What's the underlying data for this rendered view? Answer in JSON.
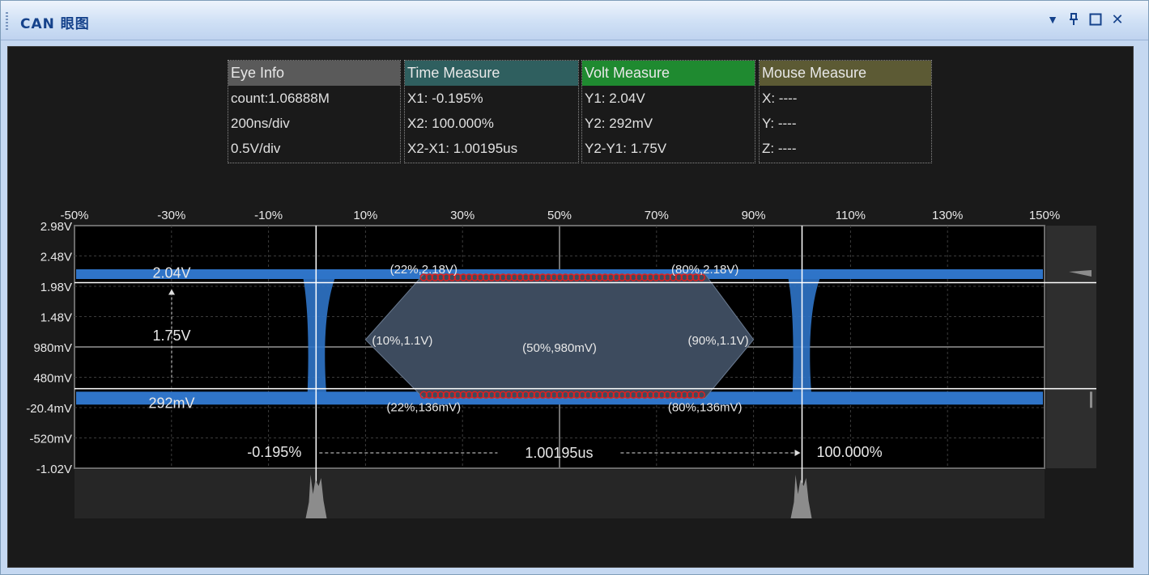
{
  "window": {
    "title": "CAN 眼图"
  },
  "info_panels": [
    {
      "title": "Eye Info",
      "color": "#5a5a5a",
      "rows": [
        "count:1.06888M",
        "200ns/div",
        "0.5V/div"
      ]
    },
    {
      "title": "Time Measure",
      "color": "#2f5f5f",
      "rows": [
        "X1: -0.195%",
        "X2: 100.000%",
        "X2-X1: 1.00195us"
      ]
    },
    {
      "title": "Volt Measure",
      "color": "#1f8a30",
      "rows": [
        "Y1: 2.04V",
        "Y2: 292mV",
        "Y2-Y1: 1.75V"
      ]
    },
    {
      "title": "Mouse Measure",
      "color": "#5c5a34",
      "rows": [
        "X: ----",
        "Y: ----",
        "Z: ----"
      ]
    }
  ],
  "chart_data": {
    "type": "eye-diagram",
    "x_ticks": [
      -50,
      -30,
      -10,
      10,
      30,
      50,
      70,
      90,
      110,
      130,
      150
    ],
    "x_tick_labels": [
      "-50%",
      "-30%",
      "-10%",
      "10%",
      "30%",
      "50%",
      "70%",
      "90%",
      "110%",
      "130%",
      "150%"
    ],
    "y_ticks": [
      2.98,
      2.48,
      1.98,
      1.48,
      0.98,
      0.48,
      -0.0204,
      -0.52,
      -1.02
    ],
    "y_tick_labels": [
      "2.98V",
      "2.48V",
      "1.98V",
      "1.48V",
      "980mV",
      "480mV",
      "-20.4mV",
      "-520mV",
      "-1.02V"
    ],
    "xlim": [
      -50,
      150
    ],
    "ylim": [
      -1.02,
      2.98
    ],
    "grid": true,
    "high_level": 2.18,
    "low_level": 0.136,
    "crossings": [
      0,
      100
    ],
    "cursors": {
      "x1": {
        "value": -0.195,
        "label": "-0.195%"
      },
      "x2": {
        "value": 100.0,
        "label": "100.000%"
      },
      "dx_label": "1.00195us",
      "y1": {
        "value": 2.04,
        "label": "2.04V"
      },
      "y2": {
        "value": 0.292,
        "label": "292mV"
      },
      "dy_label": "1.75V"
    },
    "mask_points": [
      {
        "x": 10,
        "y": 1.1,
        "label": "(10%,1.1V)"
      },
      {
        "x": 22,
        "y": 2.18,
        "label": "(22%,2.18V)"
      },
      {
        "x": 80,
        "y": 2.18,
        "label": "(80%,2.18V)"
      },
      {
        "x": 90,
        "y": 1.1,
        "label": "(90%,1.1V)"
      },
      {
        "x": 80,
        "y": 0.136,
        "label": "(80%,136mV)"
      },
      {
        "x": 22,
        "y": 0.136,
        "label": "(22%,136mV)"
      }
    ],
    "center_point": {
      "x": 50,
      "y": 0.98,
      "label": "(50%,980mV)"
    },
    "colors": {
      "trace": "#2f74c8",
      "mask": "#3d4b5e",
      "violation": "#e02020",
      "histogram": "#8c8c8c",
      "cursor": "#ffffff"
    }
  }
}
